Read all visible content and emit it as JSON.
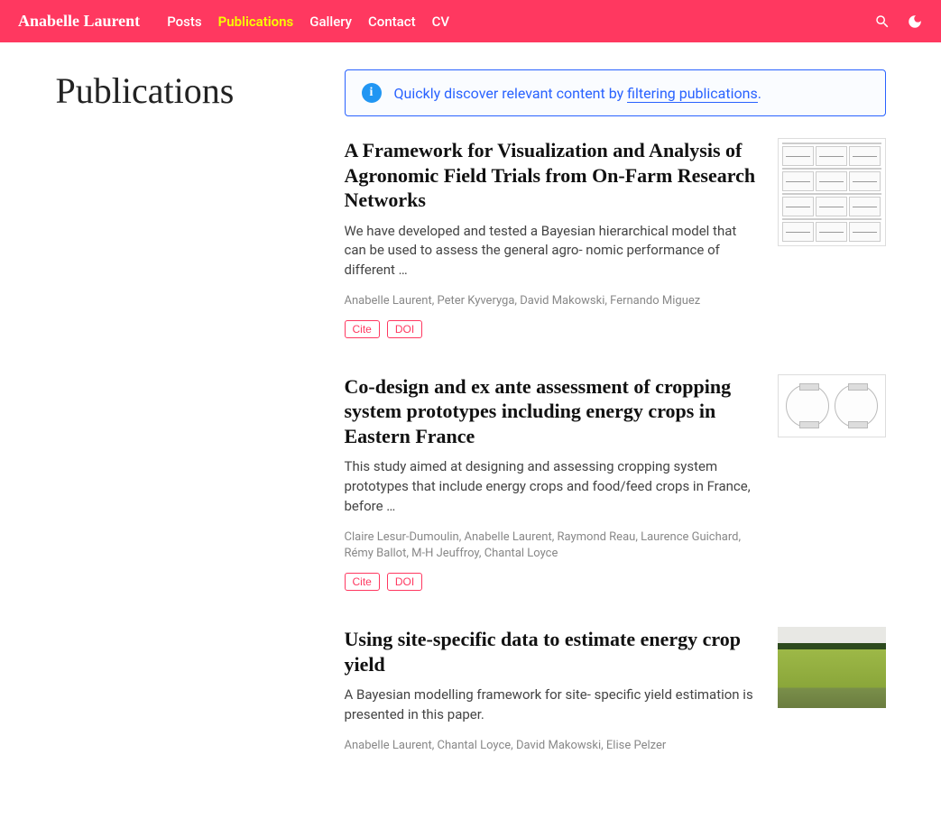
{
  "brand": "Anabelle Laurent",
  "nav": {
    "items": [
      {
        "label": "Posts",
        "active": false
      },
      {
        "label": "Publications",
        "active": true
      },
      {
        "label": "Gallery",
        "active": false
      },
      {
        "label": "Contact",
        "active": false
      },
      {
        "label": "CV",
        "active": false
      }
    ]
  },
  "page_title": "Publications",
  "alert": {
    "pre": "Quickly discover relevant content by ",
    "link": "filtering publications",
    "post": "."
  },
  "publications": [
    {
      "title": "A Framework for Visualization and Analysis of Agronomic Field Trials from On-Farm Research Networks",
      "abstract": "We have developed and tested a Bayesian hierarchical model that can be used to assess the general agro- nomic performance of different …",
      "authors": "Anabelle Laurent, Peter Kyveryga, David Makowski, Fernando Miguez",
      "buttons": [
        "Cite",
        "DOI"
      ]
    },
    {
      "title": "Co-design and ex ante assessment of cropping system prototypes including energy crops in Eastern France",
      "abstract": "This study aimed at designing and assessing cropping system prototypes that include energy crops and food/feed crops in France, before …",
      "authors": "Claire Lesur-Dumoulin, Anabelle Laurent, Raymond Reau, Laurence Guichard, Rémy Ballot, M-H Jeuffroy, Chantal Loyce",
      "buttons": [
        "Cite",
        "DOI"
      ]
    },
    {
      "title": "Using site-specific data to estimate energy crop yield",
      "abstract": "A Bayesian modelling framework for site- specific yield estimation is presented in this paper.",
      "authors": "Anabelle Laurent, Chantal Loyce, David Makowski, Elise Pelzer",
      "buttons": []
    }
  ]
}
